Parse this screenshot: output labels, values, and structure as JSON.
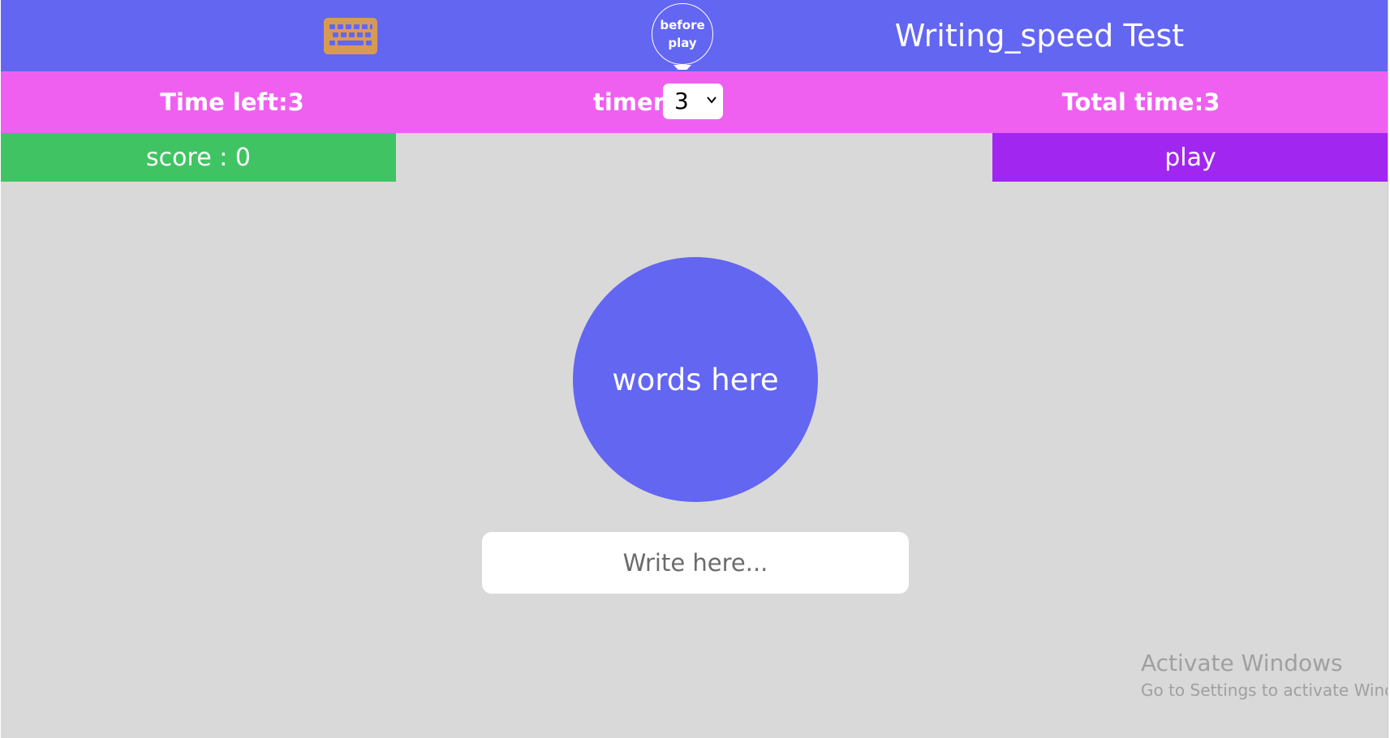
{
  "header": {
    "icon": "keyboard-icon",
    "tooltip": "before play",
    "title": "Writing_speed Test"
  },
  "timer_bar": {
    "time_left": "Time left:3",
    "timer_label": "timer",
    "timer_selected": "3",
    "total_time": "Total time:3"
  },
  "score": {
    "label": "score : 0"
  },
  "play": {
    "label": "play"
  },
  "main": {
    "word": "words here",
    "input_placeholder": "Write here...",
    "input_value": ""
  },
  "watermark": {
    "title": "Activate Windows",
    "subtitle": "Go to Settings to activate Windo"
  },
  "colors": {
    "header": "#6366f1",
    "timer_bar": "#f060f0",
    "score": "#40c463",
    "play": "#a126f0",
    "background": "#d9d9d9",
    "keyboard_icon": "#d79a55"
  }
}
